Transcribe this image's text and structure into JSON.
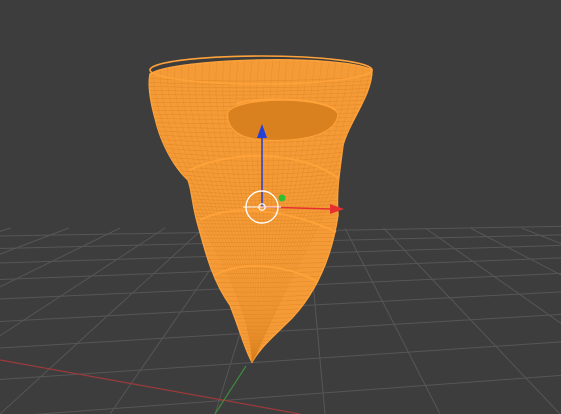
{
  "viewport": {
    "mode": "3d-viewport",
    "background_color": "#3d3d3d",
    "grid_color": "#565656",
    "x_axis_color": "#9c3a3a",
    "y_axis_color": "#3e8a3e"
  },
  "object": {
    "type": "wireframe-mesh",
    "shape": "twisted-cone",
    "state": "selected",
    "wire_color": "#ffa23a",
    "fill_color": "#f49a36",
    "shadow_color": "#d9801f"
  },
  "gizmo": {
    "type": "translate",
    "x_axis_color": "#e63030",
    "y_axis_color": "#2fbf2f",
    "z_axis_color": "#2440d9",
    "pivot_color": "#ffffff"
  }
}
